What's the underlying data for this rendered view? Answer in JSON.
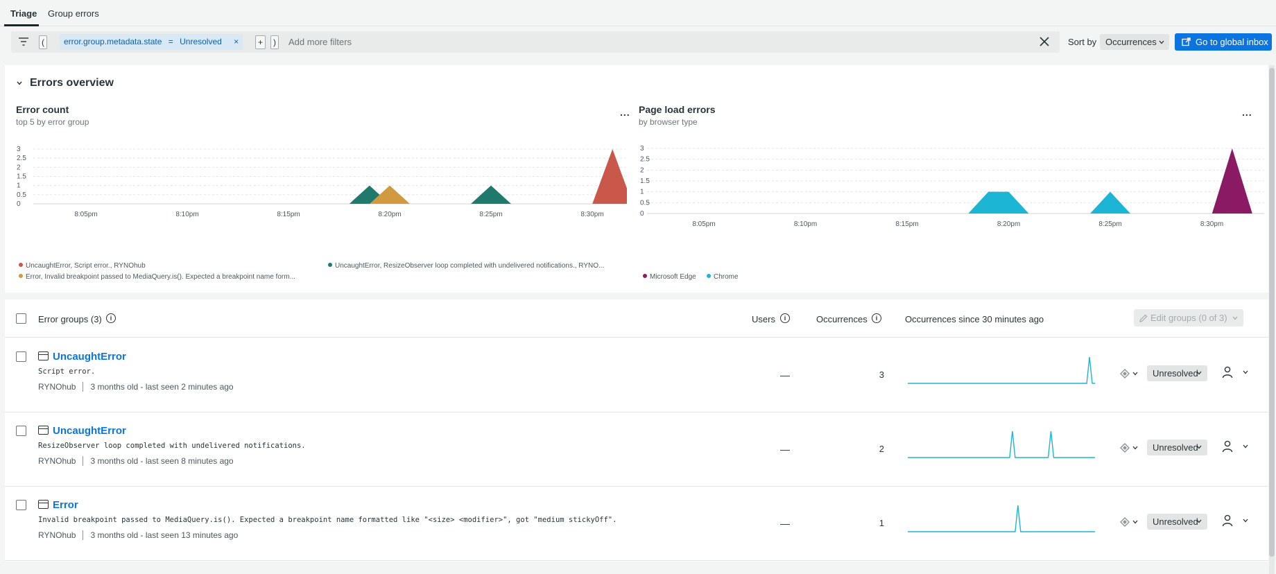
{
  "tabs": [
    {
      "label": "Triage",
      "active": true
    },
    {
      "label": "Group errors",
      "active": false
    }
  ],
  "filter": {
    "open_paren": "(",
    "close_paren": ")",
    "chip_key": "error.group.metadata.state",
    "chip_op": "=",
    "chip_value": "Unresolved",
    "chip_remove": "×",
    "add_button": "+",
    "placeholder": "Add more filters"
  },
  "sort": {
    "label": "Sort by",
    "value": "Occurrences"
  },
  "global_inbox_label": "Go to global inbox",
  "overview": {
    "title": "Errors overview",
    "kebab": "...",
    "charts": [
      {
        "title": "Error count",
        "subtitle": "top 5 by error group",
        "legend": [
          {
            "label": "UncaughtError, Script error., RYNOhub",
            "color": "#c9584a"
          },
          {
            "label": "UncaughtError, ResizeObserver loop completed with undelivered notifications., RYNO...",
            "color": "#1f7a6b"
          },
          {
            "label": "Error, Invalid breakpoint passed to MediaQuery.is(). Expected a breakpoint name form...",
            "color": "#d19a3e"
          }
        ]
      },
      {
        "title": "Page load errors",
        "subtitle": "by browser type",
        "legend": [
          {
            "label": "Microsoft Edge",
            "color": "#8a1a64"
          },
          {
            "label": "Chrome",
            "color": "#1db5d4"
          }
        ]
      }
    ]
  },
  "chart_data": [
    {
      "type": "area",
      "title": "Error count",
      "subtitle": "top 5 by error group",
      "x": [
        "8:05pm",
        "8:10pm",
        "8:15pm",
        "8:20pm",
        "8:25pm",
        "8:30pm"
      ],
      "y_ticks": [
        "0",
        "0.5",
        "1",
        "1.5",
        "2",
        "2.5",
        "3"
      ],
      "ylim": [
        0,
        3
      ],
      "grid": true,
      "legend_position": "bottom",
      "series": [
        {
          "name": "UncaughtError, Script error., RYNOhub",
          "color": "#c9584a",
          "points": [
            {
              "x": "8:31pm",
              "y": 3
            }
          ]
        },
        {
          "name": "UncaughtError, ResizeObserver loop completed with undelivered notifications., RYNO...",
          "color": "#1f7a6b",
          "points": [
            {
              "x": "8:19pm",
              "y": 1
            },
            {
              "x": "8:25pm",
              "y": 1
            }
          ]
        },
        {
          "name": "Error, Invalid breakpoint passed to MediaQuery.is(). Expected a breakpoint name form...",
          "color": "#d19a3e",
          "points": [
            {
              "x": "8:20pm",
              "y": 1
            }
          ]
        }
      ]
    },
    {
      "type": "area",
      "title": "Page load errors",
      "subtitle": "by browser type",
      "x": [
        "8:05pm",
        "8:10pm",
        "8:15pm",
        "8:20pm",
        "8:25pm",
        "8:30pm"
      ],
      "y_ticks": [
        "0",
        "0.5",
        "1",
        "1.5",
        "2",
        "2.5",
        "3"
      ],
      "ylim": [
        0,
        3
      ],
      "grid": true,
      "legend_position": "bottom",
      "series": [
        {
          "name": "Microsoft Edge",
          "color": "#8a1a64",
          "points": [
            {
              "x": "8:31pm",
              "y": 3
            }
          ]
        },
        {
          "name": "Chrome",
          "color": "#1db5d4",
          "points": [
            {
              "x": "8:19pm",
              "y": 1
            },
            {
              "x": "8:20pm",
              "y": 1
            },
            {
              "x": "8:25pm",
              "y": 1
            }
          ]
        }
      ]
    }
  ],
  "table": {
    "header": {
      "groups_label": "Error groups (3)",
      "users_label": "Users",
      "occurrences_label": "Occurrences",
      "since_label": "Occurrences since 30 minutes ago",
      "edit_label": "Edit groups (0 of 3)",
      "info_glyph": "i"
    },
    "rows": [
      {
        "title": "UncaughtError",
        "message": "Script error.",
        "app": "RYNOhub",
        "age": "3 months old - last seen 2 minutes ago",
        "users": "—",
        "occurrences": "3",
        "status": "Unresolved",
        "spark": [
          0,
          0,
          0,
          0,
          0,
          0,
          0,
          0,
          0,
          0,
          0,
          0,
          0,
          0,
          0,
          0,
          0,
          0,
          0,
          0,
          0,
          0,
          0,
          0,
          0,
          0,
          0,
          0,
          0,
          0,
          0,
          0,
          0,
          1,
          0
        ]
      },
      {
        "title": "UncaughtError",
        "message": "ResizeObserver loop completed with undelivered notifications.",
        "app": "RYNOhub",
        "age": "3 months old - last seen 8 minutes ago",
        "users": "—",
        "occurrences": "2",
        "status": "Unresolved",
        "spark": [
          0,
          0,
          0,
          0,
          0,
          0,
          0,
          0,
          0,
          0,
          0,
          0,
          0,
          0,
          0,
          0,
          0,
          0,
          0,
          1,
          0,
          0,
          0,
          0,
          0,
          0,
          1,
          0,
          0,
          0,
          0,
          0,
          0,
          0,
          0
        ]
      },
      {
        "title": "Error",
        "message": "Invalid breakpoint passed to MediaQuery.is(). Expected a breakpoint name formatted like \"<size> <modifier>\", got \"medium stickyOff\".",
        "app": "RYNOhub",
        "age": "3 months old - last seen 13 minutes ago",
        "users": "—",
        "occurrences": "1",
        "status": "Unresolved",
        "spark": [
          0,
          0,
          0,
          0,
          0,
          0,
          0,
          0,
          0,
          0,
          0,
          0,
          0,
          0,
          0,
          0,
          0,
          0,
          0,
          0,
          1,
          0,
          0,
          0,
          0,
          0,
          0,
          0,
          0,
          0,
          0,
          0,
          0,
          0,
          0
        ]
      }
    ]
  }
}
